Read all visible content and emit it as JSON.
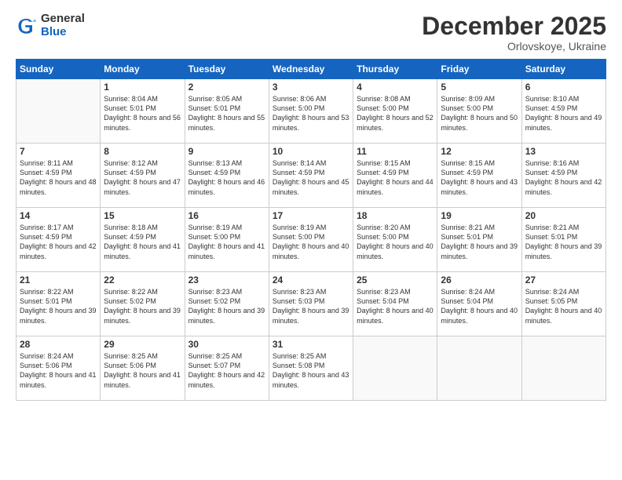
{
  "logo": {
    "general": "General",
    "blue": "Blue"
  },
  "title": "December 2025",
  "location": "Orlovskoye, Ukraine",
  "weekdays": [
    "Sunday",
    "Monday",
    "Tuesday",
    "Wednesday",
    "Thursday",
    "Friday",
    "Saturday"
  ],
  "weeks": [
    [
      {
        "day": "",
        "sunrise": "",
        "sunset": "",
        "daylight": ""
      },
      {
        "day": "1",
        "sunrise": "Sunrise: 8:04 AM",
        "sunset": "Sunset: 5:01 PM",
        "daylight": "Daylight: 8 hours and 56 minutes."
      },
      {
        "day": "2",
        "sunrise": "Sunrise: 8:05 AM",
        "sunset": "Sunset: 5:01 PM",
        "daylight": "Daylight: 8 hours and 55 minutes."
      },
      {
        "day": "3",
        "sunrise": "Sunrise: 8:06 AM",
        "sunset": "Sunset: 5:00 PM",
        "daylight": "Daylight: 8 hours and 53 minutes."
      },
      {
        "day": "4",
        "sunrise": "Sunrise: 8:08 AM",
        "sunset": "Sunset: 5:00 PM",
        "daylight": "Daylight: 8 hours and 52 minutes."
      },
      {
        "day": "5",
        "sunrise": "Sunrise: 8:09 AM",
        "sunset": "Sunset: 5:00 PM",
        "daylight": "Daylight: 8 hours and 50 minutes."
      },
      {
        "day": "6",
        "sunrise": "Sunrise: 8:10 AM",
        "sunset": "Sunset: 4:59 PM",
        "daylight": "Daylight: 8 hours and 49 minutes."
      }
    ],
    [
      {
        "day": "7",
        "sunrise": "Sunrise: 8:11 AM",
        "sunset": "Sunset: 4:59 PM",
        "daylight": "Daylight: 8 hours and 48 minutes."
      },
      {
        "day": "8",
        "sunrise": "Sunrise: 8:12 AM",
        "sunset": "Sunset: 4:59 PM",
        "daylight": "Daylight: 8 hours and 47 minutes."
      },
      {
        "day": "9",
        "sunrise": "Sunrise: 8:13 AM",
        "sunset": "Sunset: 4:59 PM",
        "daylight": "Daylight: 8 hours and 46 minutes."
      },
      {
        "day": "10",
        "sunrise": "Sunrise: 8:14 AM",
        "sunset": "Sunset: 4:59 PM",
        "daylight": "Daylight: 8 hours and 45 minutes."
      },
      {
        "day": "11",
        "sunrise": "Sunrise: 8:15 AM",
        "sunset": "Sunset: 4:59 PM",
        "daylight": "Daylight: 8 hours and 44 minutes."
      },
      {
        "day": "12",
        "sunrise": "Sunrise: 8:15 AM",
        "sunset": "Sunset: 4:59 PM",
        "daylight": "Daylight: 8 hours and 43 minutes."
      },
      {
        "day": "13",
        "sunrise": "Sunrise: 8:16 AM",
        "sunset": "Sunset: 4:59 PM",
        "daylight": "Daylight: 8 hours and 42 minutes."
      }
    ],
    [
      {
        "day": "14",
        "sunrise": "Sunrise: 8:17 AM",
        "sunset": "Sunset: 4:59 PM",
        "daylight": "Daylight: 8 hours and 42 minutes."
      },
      {
        "day": "15",
        "sunrise": "Sunrise: 8:18 AM",
        "sunset": "Sunset: 4:59 PM",
        "daylight": "Daylight: 8 hours and 41 minutes."
      },
      {
        "day": "16",
        "sunrise": "Sunrise: 8:19 AM",
        "sunset": "Sunset: 5:00 PM",
        "daylight": "Daylight: 8 hours and 41 minutes."
      },
      {
        "day": "17",
        "sunrise": "Sunrise: 8:19 AM",
        "sunset": "Sunset: 5:00 PM",
        "daylight": "Daylight: 8 hours and 40 minutes."
      },
      {
        "day": "18",
        "sunrise": "Sunrise: 8:20 AM",
        "sunset": "Sunset: 5:00 PM",
        "daylight": "Daylight: 8 hours and 40 minutes."
      },
      {
        "day": "19",
        "sunrise": "Sunrise: 8:21 AM",
        "sunset": "Sunset: 5:01 PM",
        "daylight": "Daylight: 8 hours and 39 minutes."
      },
      {
        "day": "20",
        "sunrise": "Sunrise: 8:21 AM",
        "sunset": "Sunset: 5:01 PM",
        "daylight": "Daylight: 8 hours and 39 minutes."
      }
    ],
    [
      {
        "day": "21",
        "sunrise": "Sunrise: 8:22 AM",
        "sunset": "Sunset: 5:01 PM",
        "daylight": "Daylight: 8 hours and 39 minutes."
      },
      {
        "day": "22",
        "sunrise": "Sunrise: 8:22 AM",
        "sunset": "Sunset: 5:02 PM",
        "daylight": "Daylight: 8 hours and 39 minutes."
      },
      {
        "day": "23",
        "sunrise": "Sunrise: 8:23 AM",
        "sunset": "Sunset: 5:02 PM",
        "daylight": "Daylight: 8 hours and 39 minutes."
      },
      {
        "day": "24",
        "sunrise": "Sunrise: 8:23 AM",
        "sunset": "Sunset: 5:03 PM",
        "daylight": "Daylight: 8 hours and 39 minutes."
      },
      {
        "day": "25",
        "sunrise": "Sunrise: 8:23 AM",
        "sunset": "Sunset: 5:04 PM",
        "daylight": "Daylight: 8 hours and 40 minutes."
      },
      {
        "day": "26",
        "sunrise": "Sunrise: 8:24 AM",
        "sunset": "Sunset: 5:04 PM",
        "daylight": "Daylight: 8 hours and 40 minutes."
      },
      {
        "day": "27",
        "sunrise": "Sunrise: 8:24 AM",
        "sunset": "Sunset: 5:05 PM",
        "daylight": "Daylight: 8 hours and 40 minutes."
      }
    ],
    [
      {
        "day": "28",
        "sunrise": "Sunrise: 8:24 AM",
        "sunset": "Sunset: 5:06 PM",
        "daylight": "Daylight: 8 hours and 41 minutes."
      },
      {
        "day": "29",
        "sunrise": "Sunrise: 8:25 AM",
        "sunset": "Sunset: 5:06 PM",
        "daylight": "Daylight: 8 hours and 41 minutes."
      },
      {
        "day": "30",
        "sunrise": "Sunrise: 8:25 AM",
        "sunset": "Sunset: 5:07 PM",
        "daylight": "Daylight: 8 hours and 42 minutes."
      },
      {
        "day": "31",
        "sunrise": "Sunrise: 8:25 AM",
        "sunset": "Sunset: 5:08 PM",
        "daylight": "Daylight: 8 hours and 43 minutes."
      },
      {
        "day": "",
        "sunrise": "",
        "sunset": "",
        "daylight": ""
      },
      {
        "day": "",
        "sunrise": "",
        "sunset": "",
        "daylight": ""
      },
      {
        "day": "",
        "sunrise": "",
        "sunset": "",
        "daylight": ""
      }
    ]
  ]
}
